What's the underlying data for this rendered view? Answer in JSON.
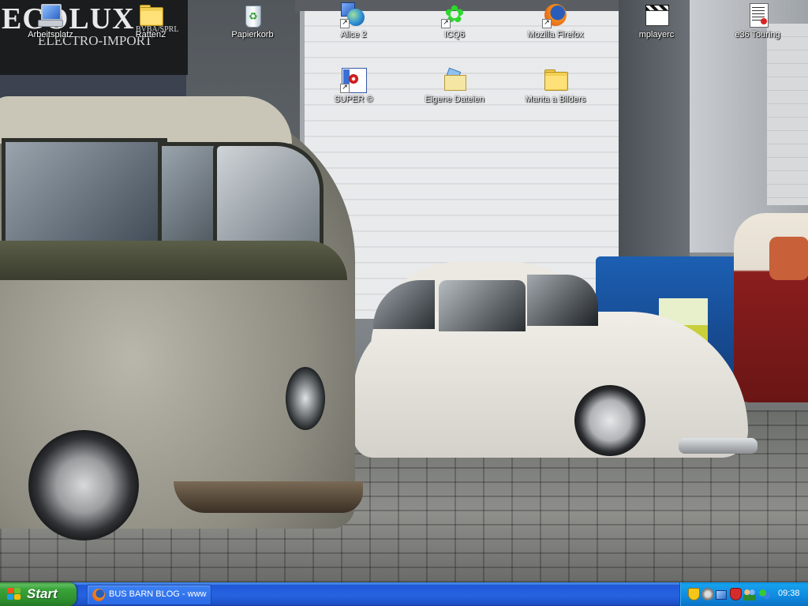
{
  "desktop": {
    "icons": [
      {
        "label": "Arbeitsplatz",
        "icon": "my-computer-icon"
      },
      {
        "label": "Ratten2",
        "icon": "folder-icon"
      },
      {
        "label": "Papierkorb",
        "icon": "recycle-bin-icon"
      },
      {
        "label": "Alice 2",
        "icon": "alice-globe-icon",
        "shortcut": true
      },
      {
        "label": "ICQ6",
        "icon": "icq-flower-icon",
        "shortcut": true
      },
      {
        "label": "Mozilla Firefox",
        "icon": "firefox-icon",
        "shortcut": true
      },
      {
        "label": "mplayerc",
        "icon": "clapperboard-icon"
      },
      {
        "label": "e36 Touring",
        "icon": "document-icon"
      },
      {
        "label": "SUPER ©",
        "icon": "super-player-icon",
        "shortcut": true
      },
      {
        "label": "Eigene Dateien",
        "icon": "my-documents-icon"
      },
      {
        "label": "Manta a Bilders",
        "icon": "folder-icon"
      }
    ],
    "shortcut_arrow": "↗",
    "wallpaper": {
      "sign_main": "ECOLUX",
      "sign_sub": "ELECTRO-IMPORT",
      "sign_small": "BVBA/SPRL"
    }
  },
  "taskbar": {
    "start_label": "Start",
    "tasks": [
      {
        "label": "BUS BARN BLOG - www...",
        "icon": "firefox-icon"
      }
    ],
    "tray": {
      "icons": [
        "security-shield-icon",
        "network-icon",
        "display-icon",
        "antivirus-icon",
        "users-icon",
        "volume-icon",
        "messenger-icon"
      ],
      "clock": "09:38"
    }
  },
  "colors": {
    "taskbar_blue": "#2663e0",
    "start_green": "#39a339",
    "tray_blue": "#0f8ae0"
  }
}
